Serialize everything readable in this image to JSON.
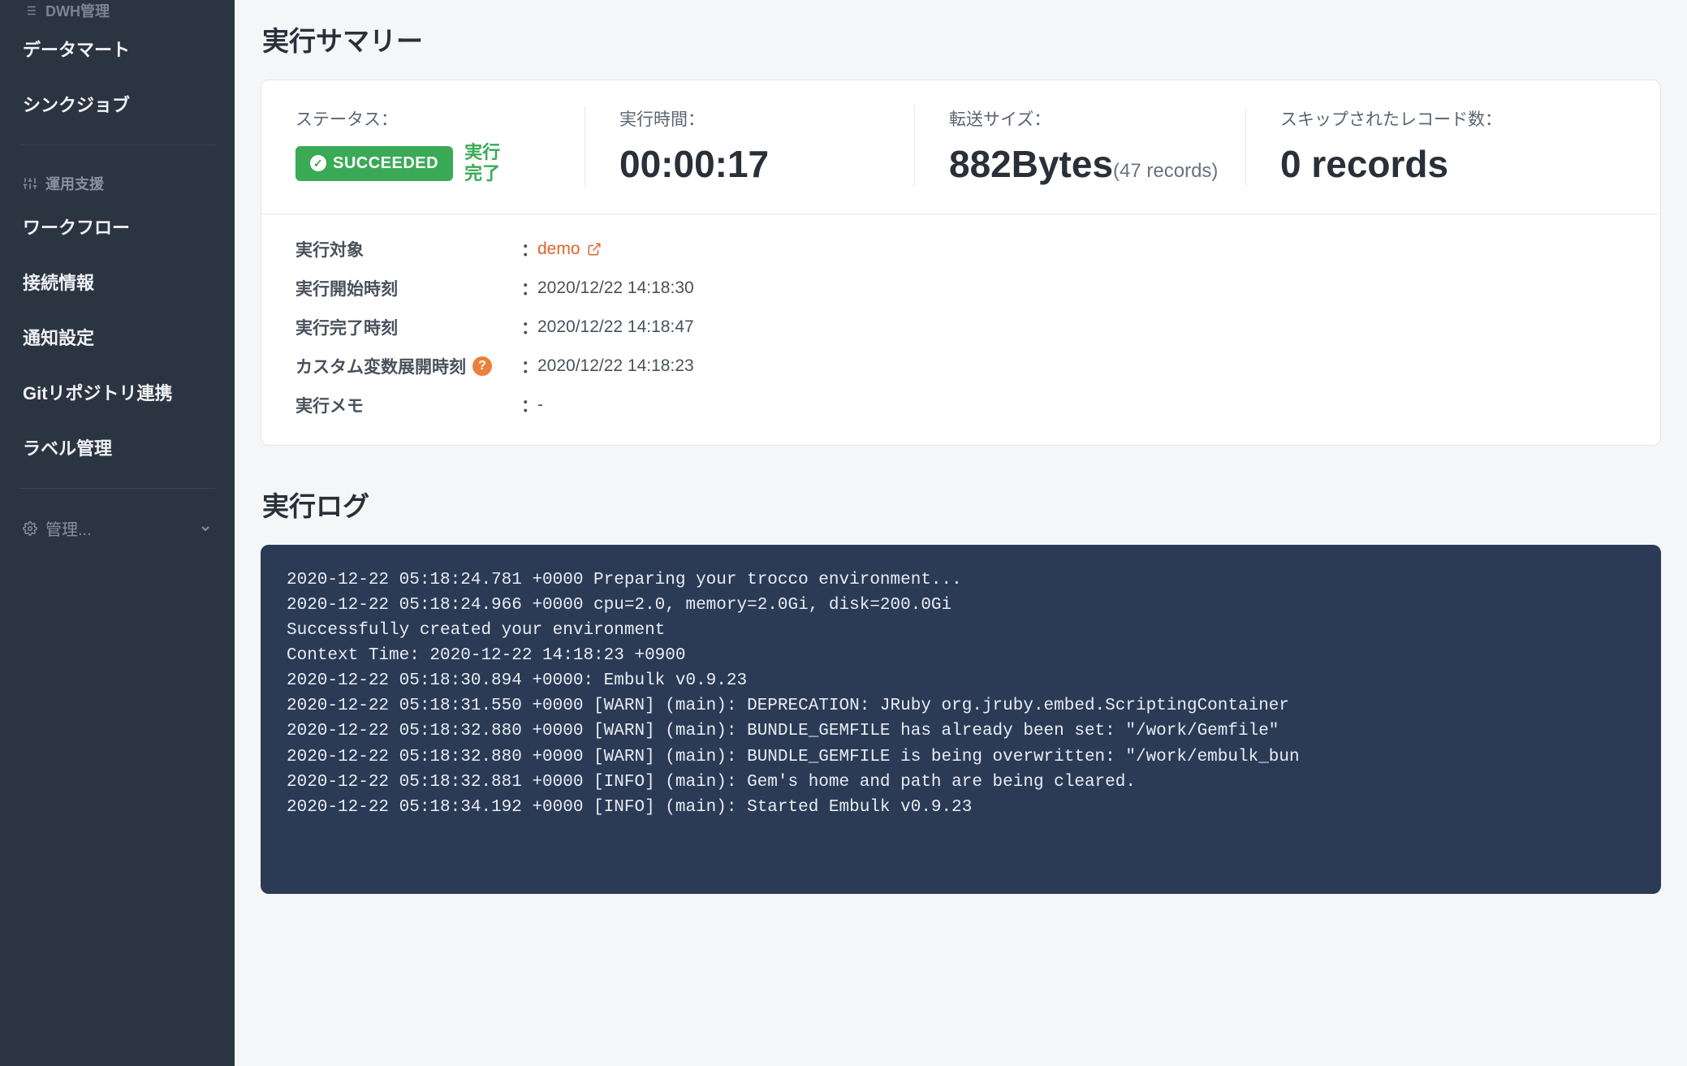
{
  "sidebar": {
    "group_dwh": {
      "label": "DWH管理"
    },
    "items_dwh": [
      {
        "label": "データマート"
      },
      {
        "label": "シンクジョブ"
      }
    ],
    "group_ops": {
      "label": "運用支援"
    },
    "items_ops": [
      {
        "label": "ワークフロー"
      },
      {
        "label": "接続情報"
      },
      {
        "label": "通知設定"
      },
      {
        "label": "Gitリポジトリ連携"
      },
      {
        "label": "ラベル管理"
      }
    ],
    "admin": {
      "label": "管理..."
    }
  },
  "summary": {
    "title": "実行サマリー",
    "status": {
      "label": "ステータス：",
      "badge": "SUCCEEDED",
      "note": "実行完了"
    },
    "duration": {
      "label": "実行時間：",
      "value": "00:00:17"
    },
    "size": {
      "label": "転送サイズ：",
      "value": "882Bytes",
      "sub": "(47 records)"
    },
    "skipped": {
      "label": "スキップされたレコード数：",
      "value": "0 records"
    },
    "details": {
      "target_key": "実行対象",
      "target_val": "demo",
      "start_key": "実行開始時刻",
      "start_val": "2020/12/22 14:18:30",
      "end_key": "実行完了時刻",
      "end_val": "2020/12/22 14:18:47",
      "var_key": "カスタム変数展開時刻",
      "var_val": "2020/12/22 14:18:23",
      "memo_key": "実行メモ",
      "memo_val": "-"
    }
  },
  "log": {
    "title": "実行ログ",
    "lines": "2020-12-22 05:18:24.781 +0000 Preparing your trocco environment...\n2020-12-22 05:18:24.966 +0000 cpu=2.0, memory=2.0Gi, disk=200.0Gi\nSuccessfully created your environment\nContext Time: 2020-12-22 14:18:23 +0900\n2020-12-22 05:18:30.894 +0000: Embulk v0.9.23\n2020-12-22 05:18:31.550 +0000 [WARN] (main): DEPRECATION: JRuby org.jruby.embed.ScriptingContainer \n2020-12-22 05:18:32.880 +0000 [WARN] (main): BUNDLE_GEMFILE has already been set: \"/work/Gemfile\"\n2020-12-22 05:18:32.880 +0000 [WARN] (main): BUNDLE_GEMFILE is being overwritten: \"/work/embulk_bun\n2020-12-22 05:18:32.881 +0000 [INFO] (main): Gem's home and path are being cleared.\n2020-12-22 05:18:34.192 +0000 [INFO] (main): Started Embulk v0.9.23"
  }
}
